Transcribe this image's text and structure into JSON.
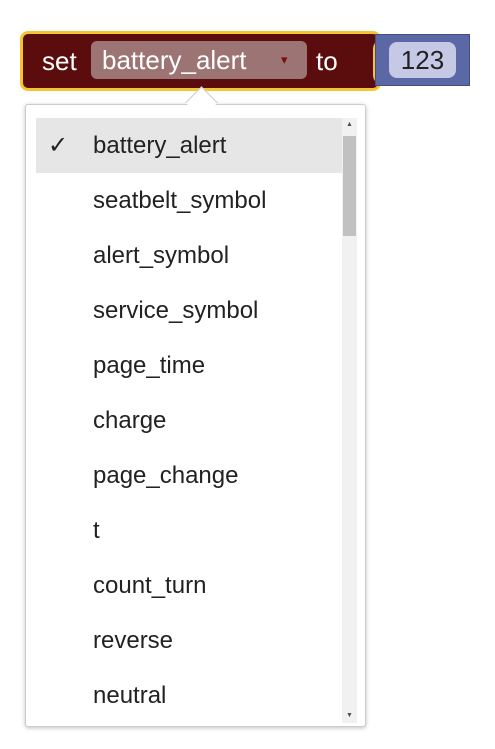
{
  "block": {
    "set_label": "set",
    "variable": "battery_alert",
    "dropdown_arrow": "▾",
    "to_label": "to",
    "value": "123",
    "colors": {
      "block": "#5b0d0d",
      "highlight": "#f5c531",
      "field": "#9d7474",
      "number_block": "#5c68a6",
      "number_field": "#c5c9e6"
    }
  },
  "menu": {
    "check_mark": "✓",
    "items": [
      {
        "label": "battery_alert",
        "selected": true
      },
      {
        "label": "seatbelt_symbol"
      },
      {
        "label": "alert_symbol"
      },
      {
        "label": "service_symbol"
      },
      {
        "label": "page_time"
      },
      {
        "label": "charge"
      },
      {
        "label": "page_change"
      },
      {
        "label": "t"
      },
      {
        "label": "count_turn"
      },
      {
        "label": "reverse"
      },
      {
        "label": "neutral"
      }
    ],
    "scroll_up": "▲",
    "scroll_down": "▼"
  }
}
